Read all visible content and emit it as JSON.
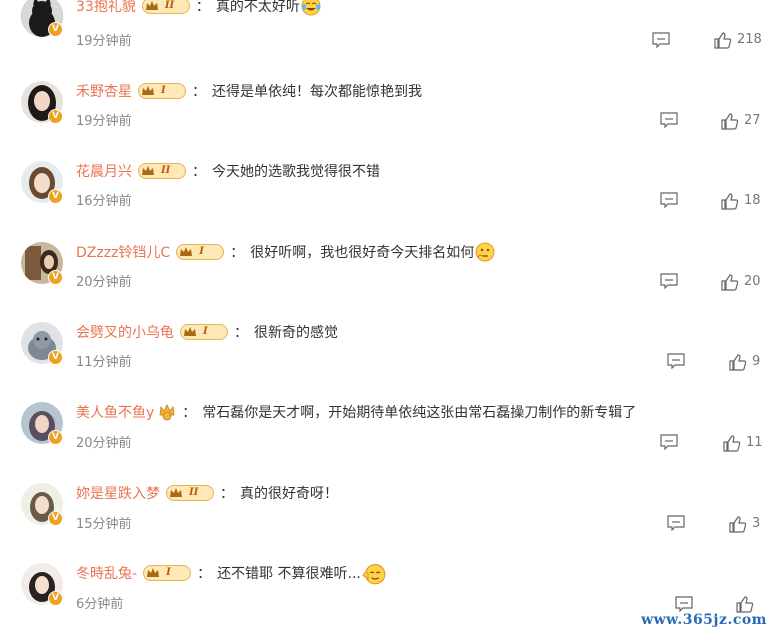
{
  "comments": [
    {
      "username": "33抱礼貌",
      "rank": "II",
      "text": "真的不太好听",
      "emoji": "laugh-cry",
      "time": "19分钟前",
      "likes": "218"
    },
    {
      "username": "禾野杏星",
      "rank": "I",
      "text": "还得是单依纯！每次都能惊艳到我",
      "time": "19分钟前",
      "likes": "27"
    },
    {
      "username": "花晨月兴",
      "rank": "II",
      "text": "今天她的选歌我觉得很不错",
      "time": "16分钟前",
      "likes": "18"
    },
    {
      "username": "DZzzz铃铛儿C",
      "rank": "I",
      "text": "很好听啊，我也很好奇今天排名如何",
      "emoji": "thinking",
      "time": "20分钟前",
      "likes": "20"
    },
    {
      "username": "会劈叉的小乌龟",
      "rank": "I",
      "text": "很新奇的感觉",
      "time": "11分钟前",
      "likes": "9"
    },
    {
      "username": "美人鱼不鱼y",
      "rank": "",
      "text": "常石磊你是天才啊，开始期待单依纯这张由常石磊操刀制作的新专辑了",
      "time": "20分钟前",
      "likes": "11"
    },
    {
      "username": "妳是星跌入梦",
      "rank": "II",
      "text": "真的很好奇呀！",
      "time": "15分钟前",
      "likes": "3"
    },
    {
      "username": "冬時乱兔-",
      "rank": "I",
      "text": "还不错耶 不算很难听...",
      "emoji": "shrug",
      "time": "6分钟前",
      "likes": ""
    }
  ],
  "watermark": "www.365jz.com",
  "colors": {
    "username": "#eb7350",
    "text": "#333333",
    "meta": "#888888",
    "vbadge": "#f0a020"
  }
}
